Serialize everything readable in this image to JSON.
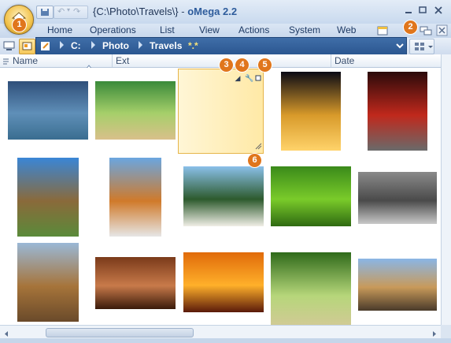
{
  "window": {
    "title_path": "{C:\\Photo\\Travels\\}",
    "title_sep": " - ",
    "title_app": "oMega 2.2"
  },
  "ribbon_tabs": [
    "Home",
    "Operations",
    "List",
    "View",
    "Actions",
    "System",
    "Web"
  ],
  "address": {
    "drive": "C:",
    "crumbs": [
      "Photo",
      "Travels"
    ],
    "filter": "*.*"
  },
  "columns": [
    "Name",
    "Ext",
    "Date"
  ],
  "callouts": [
    "1",
    "2",
    "3",
    "4",
    "5",
    "6"
  ],
  "icons": {
    "app_menu": "house-orb-icon",
    "qat_save": "save-icon",
    "qat_undo": "undo-icon",
    "qat_redo": "redo-icon",
    "minimize": "minimize-icon",
    "maximize": "maximize-icon",
    "close": "close-icon",
    "new_window": "new-window-icon",
    "panes": "panes-icon",
    "close_pane": "close-pane-icon",
    "view_mode": "thumbnail-view-icon"
  },
  "thumbnails": [
    {
      "name": "surfer-lake",
      "colors": [
        "#2f4f7a",
        "#5f8fb8",
        "#3a6d90"
      ]
    },
    {
      "name": "palm-beach",
      "colors": [
        "#3a8a3a",
        "#a6cf6a",
        "#d9c08a"
      ]
    },
    {
      "name": "couple-silhouette",
      "colors": [
        "#5fb3e0",
        "#2a6ea6",
        "#111111"
      ],
      "selected": true
    },
    {
      "name": "eiffel-night",
      "colors": [
        "#0a0a14",
        "#d89a2a",
        "#ffd36a"
      ]
    },
    {
      "name": "moulin-rouge",
      "colors": [
        "#2a0a0a",
        "#c0281c",
        "#6a6a6a"
      ]
    },
    {
      "name": "palm-tree-sky",
      "colors": [
        "#3a86d6",
        "#8a6a3a",
        "#5a8a3a"
      ]
    },
    {
      "name": "boy-with-camera",
      "colors": [
        "#6aa6e0",
        "#d07a2a",
        "#e6e6e6"
      ]
    },
    {
      "name": "beach-palms",
      "colors": [
        "#8ac0ea",
        "#2d5a2d",
        "#f0eee6"
      ]
    },
    {
      "name": "green-ferns",
      "colors": [
        "#3a8a1a",
        "#7acb2a",
        "#2f6a12"
      ]
    },
    {
      "name": "rock-sitting",
      "colors": [
        "#8a8a8a",
        "#4a4a4a",
        "#c8c8c8"
      ]
    },
    {
      "name": "sphinx",
      "colors": [
        "#9ab8d6",
        "#a6743a",
        "#6a4a2a"
      ]
    },
    {
      "name": "cave-formations",
      "colors": [
        "#7a3a1a",
        "#c87a4a",
        "#3a1a0a"
      ]
    },
    {
      "name": "sunset-sea",
      "colors": [
        "#e06a0a",
        "#ffb02a",
        "#5a1a0a"
      ]
    },
    {
      "name": "tree-avenue",
      "colors": [
        "#2f6a1a",
        "#b6d67a",
        "#d6c89a"
      ]
    },
    {
      "name": "camels-desert",
      "colors": [
        "#8ab6e6",
        "#c89a5a",
        "#4a3a2a"
      ]
    }
  ]
}
